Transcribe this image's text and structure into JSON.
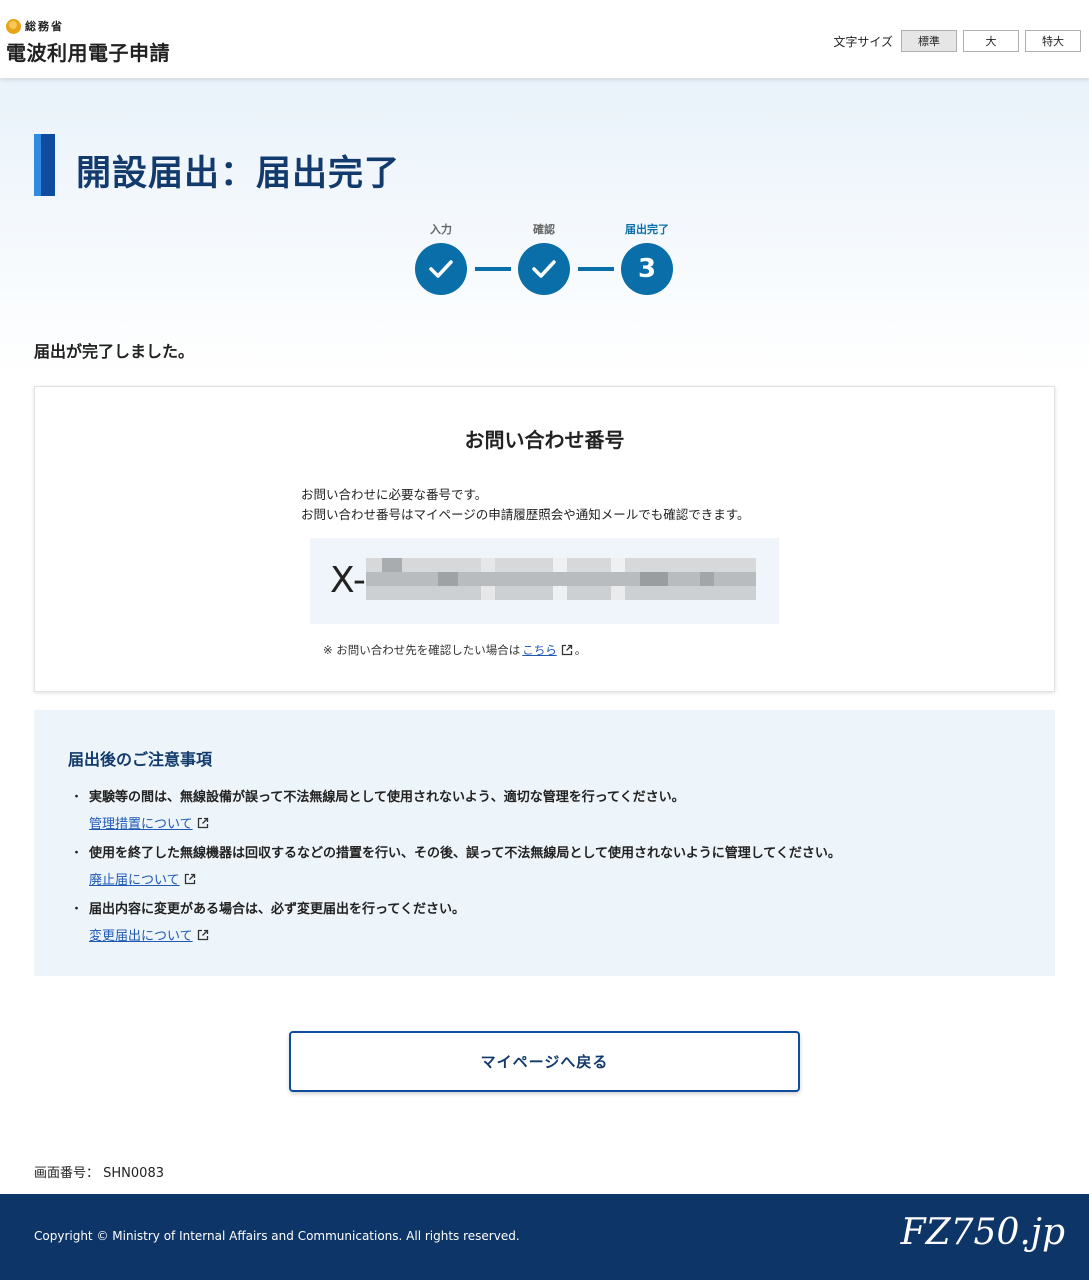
{
  "header": {
    "ministry": "総務省",
    "site_title": "電波利用電子申請",
    "font_size_label": "文字サイズ",
    "font_size_options": [
      "標準",
      "大",
      "特大"
    ]
  },
  "page": {
    "title": "開設届出：届出完了",
    "complete_message": "届出が完了しました。"
  },
  "stepper": {
    "steps": [
      {
        "label": "入力",
        "state": "done"
      },
      {
        "label": "確認",
        "state": "done"
      },
      {
        "label": "届出完了",
        "state": "current",
        "number": "3"
      }
    ]
  },
  "inquiry": {
    "title": "お問い合わせ番号",
    "desc1": "お問い合わせに必要な番号です。",
    "desc2": "お問い合わせ番号はマイページの申請履歴照会や通知メールでも確認できます。",
    "number_prefix": "X-",
    "note_prefix": "※  お問い合わせ先を確認したい場合は",
    "note_link": "こちら",
    "note_suffix": "。"
  },
  "notice": {
    "title": "届出後のご注意事項",
    "items": [
      {
        "text": "実験等の間は、無線設備が誤って不法無線局として使用されないよう、適切な管理を行ってください。",
        "link": "管理措置について"
      },
      {
        "text": "使用を終了した無線機器は回収するなどの措置を行い、その後、誤って不法無線局として使用されないように管理してください。",
        "link": "廃止届について"
      },
      {
        "text": "届出内容に変更がある場合は、必ず変更届出を行ってください。",
        "link": "変更届出について"
      }
    ]
  },
  "actions": {
    "return_label": "マイページへ戻る"
  },
  "screen": {
    "id_label": "画面番号：",
    "id_value": "SHN0083"
  },
  "footer": {
    "copyright": "Copyright © Ministry of Internal Affairs and Communications. All rights reserved.",
    "watermark": "FZ750.jp"
  },
  "colors": {
    "primary": "#0a6ea8",
    "navy": "#0d3567",
    "link": "#1f58b5"
  }
}
